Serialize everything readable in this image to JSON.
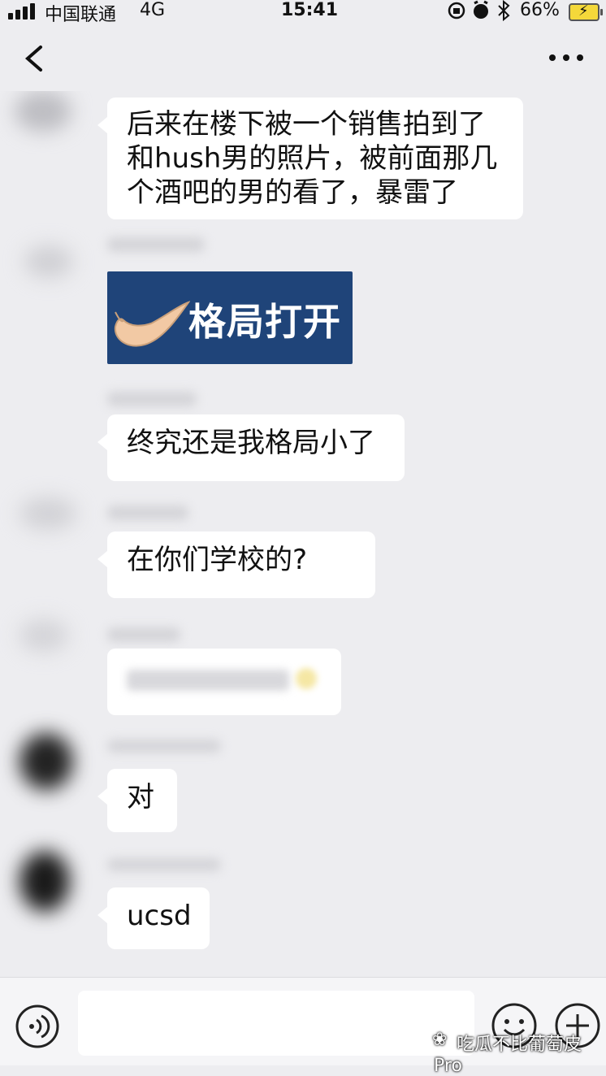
{
  "status_bar": {
    "carrier": "中国联通",
    "network": "4G",
    "time": "15:41",
    "battery_percent": "66%",
    "battery_level": 0.66
  },
  "nav": {
    "back_icon": "chevron-left-icon",
    "more_icon": "more-dots-icon"
  },
  "messages": [
    {
      "text": "后来在楼下被一个销售拍到了\n和hush男的照片，被前面那几\n个酒吧的男的看了，暴雷了"
    },
    {
      "sticker_text": "格局打开"
    },
    {
      "text": "终究还是我格局小了"
    },
    {
      "text": "在你们学校的?"
    },
    {
      "text": "对"
    },
    {
      "text": "ucsd"
    }
  ],
  "input_bar": {
    "voice_icon": "voice-icon",
    "emoji_icon": "emoji-icon",
    "plus_icon": "plus-icon",
    "watermark": "吃瓜不比葡萄皮Pro"
  }
}
